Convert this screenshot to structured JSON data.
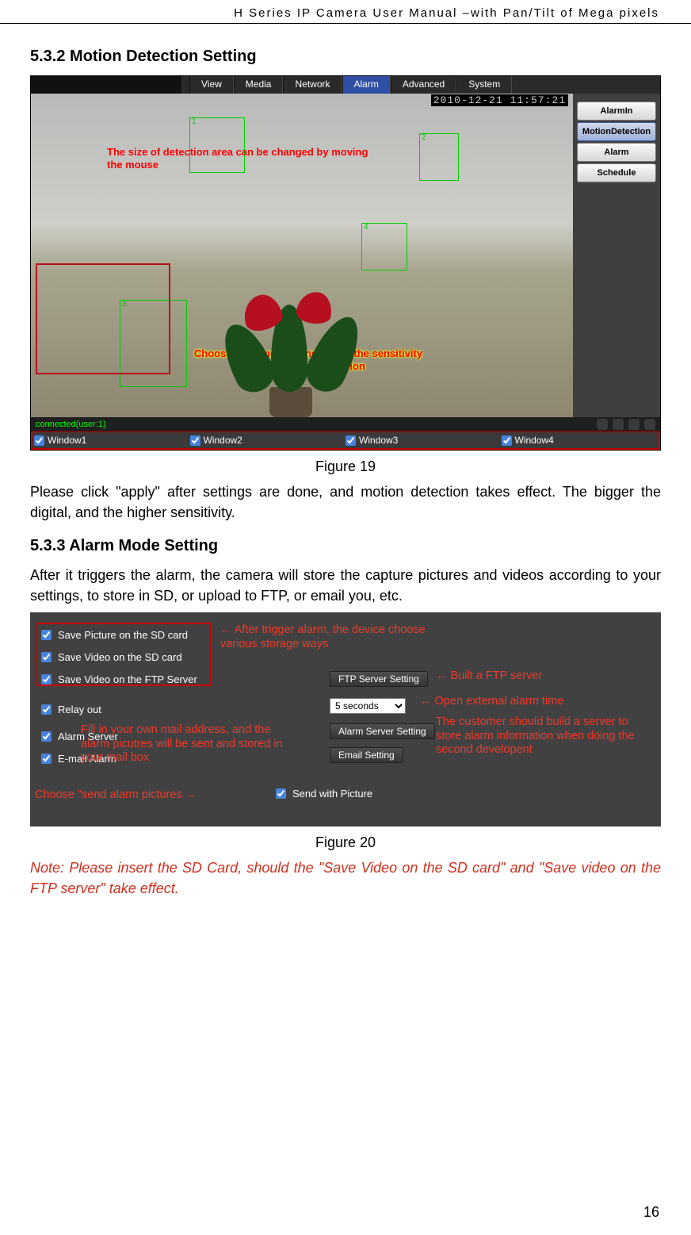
{
  "header": "H Series IP Camera User Manual –with Pan/Tilt of Mega pixels",
  "page_number": "16",
  "section_532": {
    "title": "5.3.2   Motion Detection Setting"
  },
  "fig19": {
    "nav": [
      "View",
      "Media",
      "Network",
      "Alarm",
      "Advanced",
      "System"
    ],
    "active_nav_index": 3,
    "timestamp": "2010-12-21 11:57:21",
    "annot_size": "The size of detection area can be changed by moving the mouse",
    "annot_choose": "Choose the windows and adjust the sensitivity of the motion detection",
    "status": "connected(user:1)",
    "sidebar": [
      "AlarmIn",
      "MotionDetection",
      "Alarm",
      "Schedule"
    ],
    "active_side_index": 1,
    "windows": [
      "Window1",
      "Window2",
      "Window3",
      "Window4"
    ],
    "caption": "Figure 19"
  },
  "para19": "Please click \"apply\" after settings are done, and motion detection takes effect. The bigger the digital, and the higher sensitivity.",
  "section_533": {
    "title": "5.3.3   Alarm Mode Setting"
  },
  "para533": "After it triggers the alarm, the camera will store the capture pictures and videos according to your settings, to store in SD, or upload to FTP, or email you, etc.",
  "fig20": {
    "rows": {
      "save_pic_sd": "Save Picture on the SD card",
      "save_vid_sd": "Save Video on the SD card",
      "save_vid_ftp": "Save Video on the FTP Server",
      "relay": "Relay out",
      "alarm_server": "Alarm Server",
      "email": "E-mail Alarm",
      "send_pic": "Send with Picture"
    },
    "buttons": {
      "ftp": "FTP Server Setting",
      "alarm_srv": "Alarm Server Setting",
      "email": "Email Setting"
    },
    "select_seconds": "5 seconds",
    "annot": {
      "trigger": "After trigger alarm, the device choose various storage ways",
      "ftp": "Built a FTP server",
      "relay": "Open external alarm time",
      "alarmserver": "The customer should build a server to store alarm information when doing the second developent",
      "email": "Fill in your own mail address, and the alarm picutres will be sent and stored in your mail box",
      "sendpic": "Choose \"send alarm pictures"
    },
    "caption": "Figure 20"
  },
  "note20": "Note: Please insert the SD Card, should the \"Save Video on the SD card\" and \"Save video on the FTP server\" take effect."
}
